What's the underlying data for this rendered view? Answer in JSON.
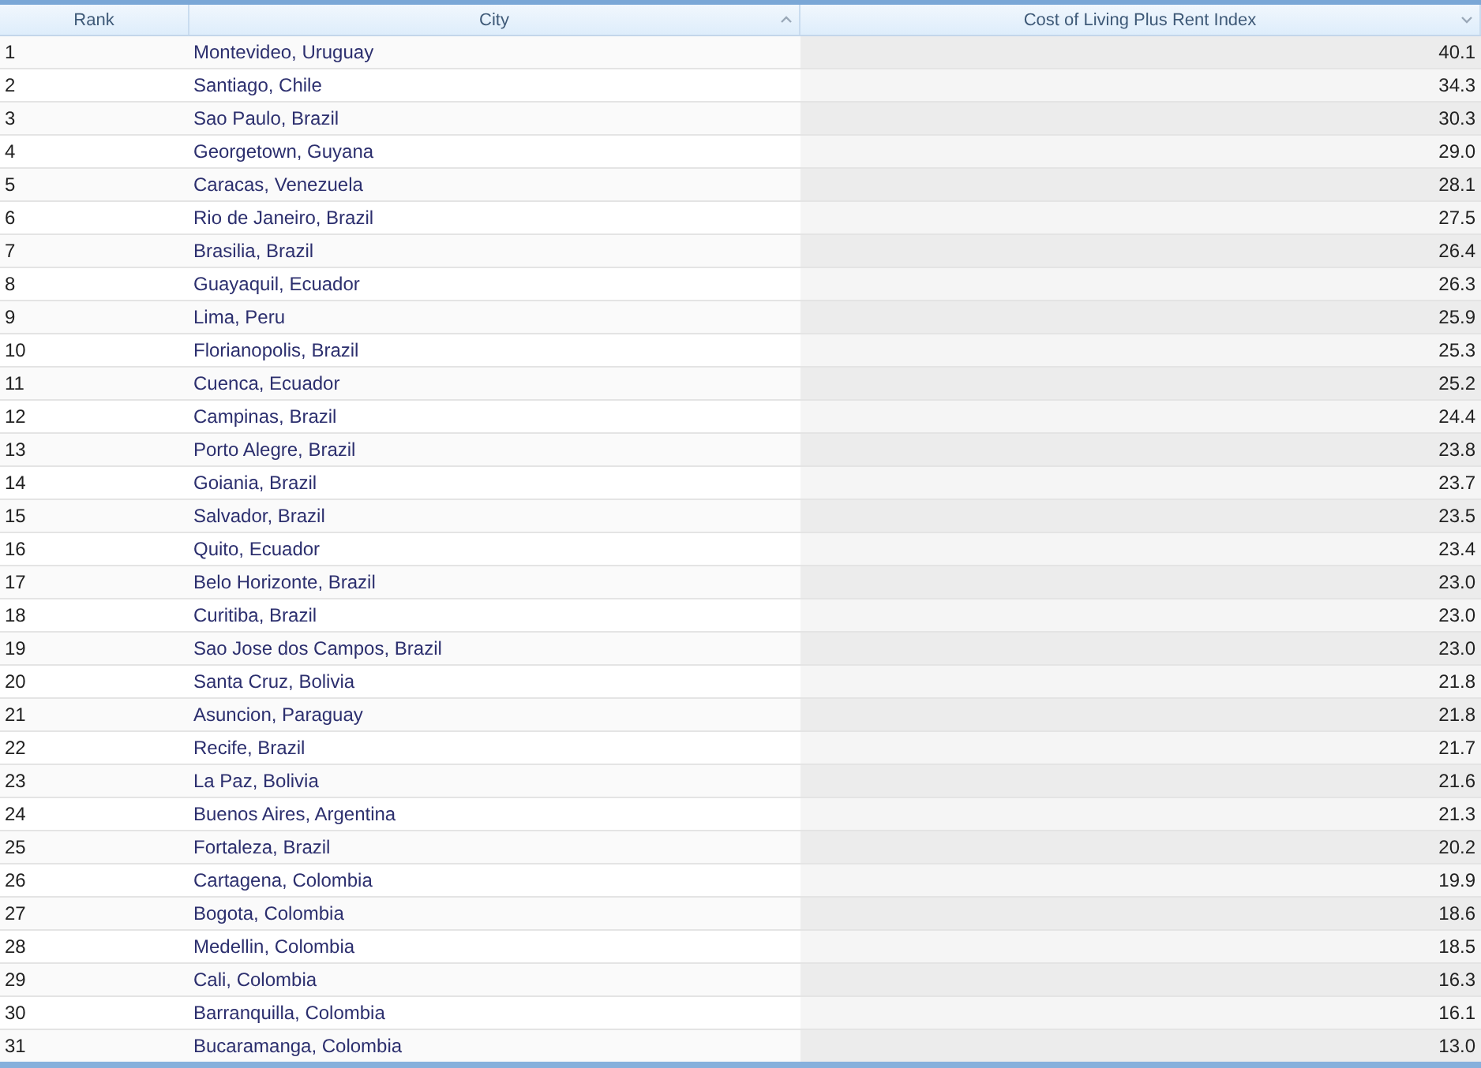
{
  "table": {
    "columns": [
      {
        "label": "Rank",
        "sort_up": false,
        "sort_down": false,
        "shaded": false,
        "numeric": false
      },
      {
        "label": "City",
        "sort_up": true,
        "sort_down": false,
        "shaded": false,
        "numeric": false
      },
      {
        "label": "Cost of Living Plus Rent Index",
        "sort_up": false,
        "sort_down": true,
        "shaded": true,
        "numeric": true
      }
    ],
    "rows": [
      [
        "1",
        "Montevideo, Uruguay",
        "40.1"
      ],
      [
        "2",
        "Santiago, Chile",
        "34.3"
      ],
      [
        "3",
        "Sao Paulo, Brazil",
        "30.3"
      ],
      [
        "4",
        "Georgetown, Guyana",
        "29.0"
      ],
      [
        "5",
        "Caracas, Venezuela",
        "28.1"
      ],
      [
        "6",
        "Rio de Janeiro, Brazil",
        "27.5"
      ],
      [
        "7",
        "Brasilia, Brazil",
        "26.4"
      ],
      [
        "8",
        "Guayaquil, Ecuador",
        "26.3"
      ],
      [
        "9",
        "Lima, Peru",
        "25.9"
      ],
      [
        "10",
        "Florianopolis, Brazil",
        "25.3"
      ],
      [
        "11",
        "Cuenca, Ecuador",
        "25.2"
      ],
      [
        "12",
        "Campinas, Brazil",
        "24.4"
      ],
      [
        "13",
        "Porto Alegre, Brazil",
        "23.8"
      ],
      [
        "14",
        "Goiania, Brazil",
        "23.7"
      ],
      [
        "15",
        "Salvador, Brazil",
        "23.5"
      ],
      [
        "16",
        "Quito, Ecuador",
        "23.4"
      ],
      [
        "17",
        "Belo Horizonte, Brazil",
        "23.0"
      ],
      [
        "18",
        "Curitiba, Brazil",
        "23.0"
      ],
      [
        "19",
        "Sao Jose dos Campos, Brazil",
        "23.0"
      ],
      [
        "20",
        "Santa Cruz, Bolivia",
        "21.8"
      ],
      [
        "21",
        "Asuncion, Paraguay",
        "21.8"
      ],
      [
        "22",
        "Recife, Brazil",
        "21.7"
      ],
      [
        "23",
        "La Paz, Bolivia",
        "21.6"
      ],
      [
        "24",
        "Buenos Aires, Argentina",
        "21.3"
      ],
      [
        "25",
        "Fortaleza, Brazil",
        "20.2"
      ],
      [
        "26",
        "Cartagena, Colombia",
        "19.9"
      ],
      [
        "27",
        "Bogota, Colombia",
        "18.6"
      ],
      [
        "28",
        "Medellin, Colombia",
        "18.5"
      ],
      [
        "29",
        "Cali, Colombia",
        "16.3"
      ],
      [
        "30",
        "Barranquilla, Colombia",
        "16.1"
      ],
      [
        "31",
        "Bucaramanga, Colombia",
        "13.0"
      ]
    ]
  }
}
